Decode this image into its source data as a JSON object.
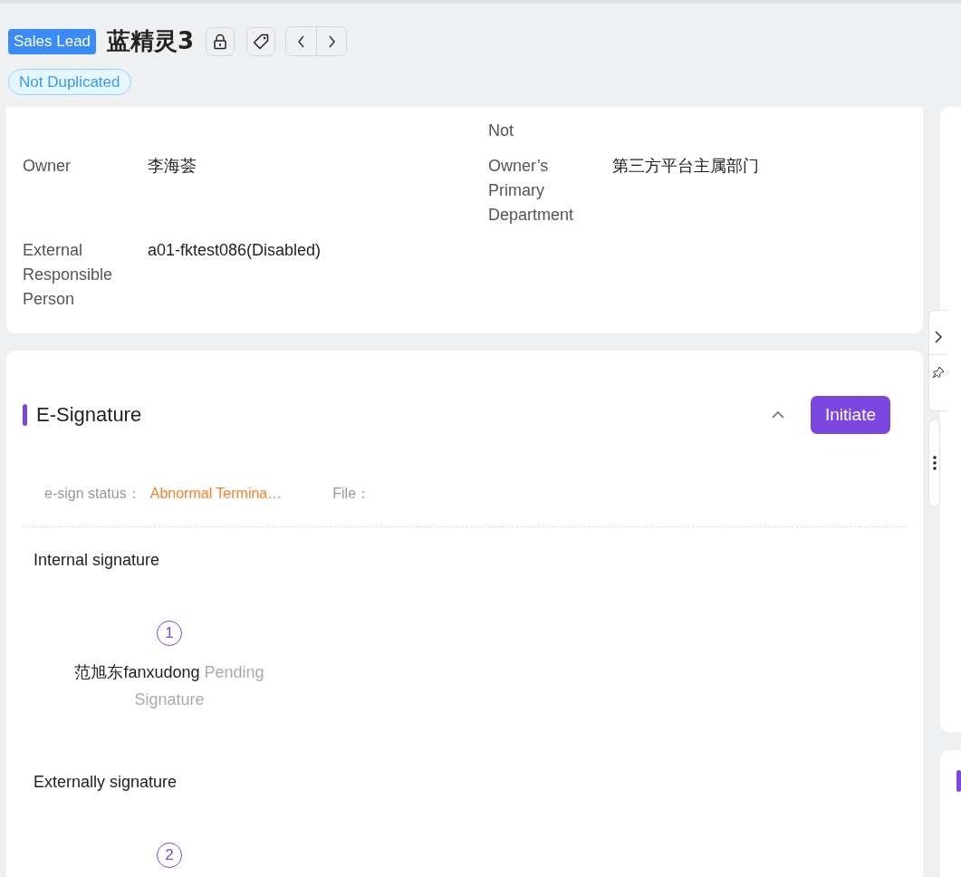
{
  "header": {
    "badge": "Sales Lead",
    "title": "蓝精灵3",
    "tag": "Not Duplicated"
  },
  "detail_rows": [
    {
      "right": {
        "label": "Not"
      }
    },
    {
      "left": {
        "label": "Owner",
        "value": "李海荟"
      },
      "right": {
        "label": "Owner’s Primary Department",
        "value": "第三方平台主属部门"
      }
    },
    {
      "left": {
        "label": "External Responsible Person",
        "value": "a01-fktest086(Disabled)"
      }
    }
  ],
  "esign": {
    "title": "E-Signature",
    "expanded": true,
    "initiate_button": "Initiate",
    "status_label": "e-sign status：",
    "status_value": "Abnormal Termina…",
    "file_label": "File：",
    "sections": [
      {
        "title": "Internal signature",
        "signers": [
          {
            "step": "1",
            "name": "范旭东fanxudong",
            "status": "Pending Signature"
          }
        ]
      },
      {
        "title": "Externally signature",
        "signers": [
          {
            "step": "2"
          }
        ]
      }
    ]
  }
}
